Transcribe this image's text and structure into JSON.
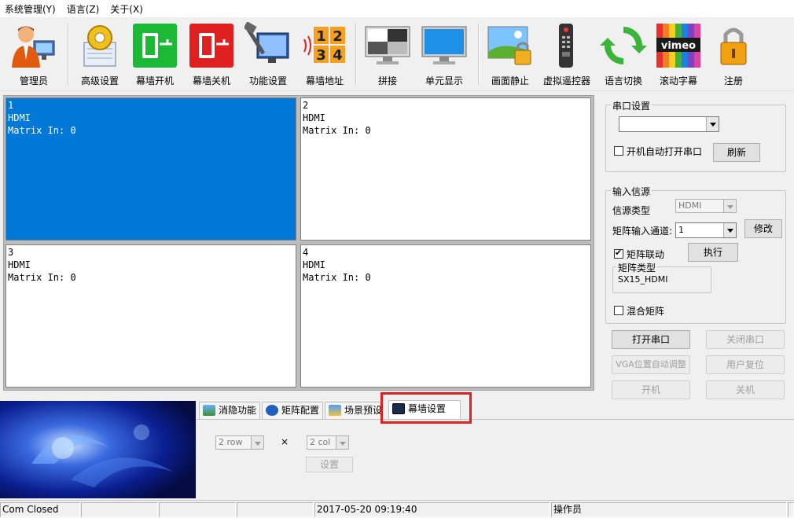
{
  "menu": [
    "系统管理(Y)",
    "语言(Z)",
    "关于(X)"
  ],
  "toolbar": [
    {
      "label": "管理员",
      "icon": "admin-user-icon"
    },
    {
      "label": "高级设置",
      "icon": "advanced-settings-icon"
    },
    {
      "label": "幕墙开机",
      "icon": "wall-power-on-icon"
    },
    {
      "label": "幕墙关机",
      "icon": "wall-power-off-icon"
    },
    {
      "label": "功能设置",
      "icon": "function-settings-icon"
    },
    {
      "label": "幕墙地址",
      "icon": "wall-address-icon"
    },
    {
      "label": "拼接",
      "icon": "splice-monitor-icon"
    },
    {
      "label": "单元显示",
      "icon": "unit-display-monitor-icon"
    },
    {
      "label": "画面静止",
      "icon": "freeze-picture-icon"
    },
    {
      "label": "虚拟遥控器",
      "icon": "remote-control-icon"
    },
    {
      "label": "语言切换",
      "icon": "language-switch-icon"
    },
    {
      "label": "滚动字幕",
      "icon": "scrolling-subtitle-icon"
    },
    {
      "label": "注册",
      "icon": "register-lock-icon"
    }
  ],
  "toolbar_icon_texts": {
    "address_digits": [
      "1",
      "2",
      "3",
      "4"
    ],
    "vimeo_text": "vimeo"
  },
  "screens": [
    {
      "number": "1",
      "source": "HDMI",
      "matrix": "Matrix In: 0",
      "selected": true
    },
    {
      "number": "2",
      "source": "HDMI",
      "matrix": "Matrix In: 0",
      "selected": false
    },
    {
      "number": "3",
      "source": "HDMI",
      "matrix": "Matrix In: 0",
      "selected": false
    },
    {
      "number": "4",
      "source": "HDMI",
      "matrix": "Matrix In: 0",
      "selected": false
    }
  ],
  "serial": {
    "title": "串口设置",
    "port_value": "",
    "auto_open_label": "开机自动打开串口",
    "auto_open_checked": false,
    "refresh_label": "刷新"
  },
  "input": {
    "title": "输入信源",
    "source_type_label": "信源类型",
    "source_type_value": "HDMI",
    "matrix_channel_label": "矩阵输入通道:",
    "matrix_channel_value": "1",
    "modify_label": "修改",
    "matrix_link_label": "矩阵联动",
    "matrix_link_checked": true,
    "execute_label": "执行",
    "matrix_type_title": "矩阵类型",
    "matrix_type_value": "SX15_HDMI",
    "mixed_matrix_label": "混合矩阵",
    "mixed_matrix_checked": false
  },
  "buttons": {
    "open_serial": "打开串口",
    "close_serial": "关闭串口",
    "vga_auto": "VGA位置自动调整",
    "user_reset": "用户复位",
    "power_on": "开机",
    "power_off": "关机"
  },
  "tabs": [
    {
      "label": "消隐功能",
      "icon": "blanking-icon"
    },
    {
      "label": "矩阵配置",
      "icon": "matrix-config-icon"
    },
    {
      "label": "场景预设",
      "icon": "scene-preset-icon"
    },
    {
      "label": "幕墙设置",
      "icon": "wall-settings-icon",
      "active": true
    }
  ],
  "wall_settings": {
    "rows_value": "2 row",
    "times_symbol": "×",
    "cols_value": "2 col",
    "set_label": "设置"
  },
  "status": [
    "Com Closed",
    "",
    "",
    "",
    "2017-05-20 09:19:40",
    "操作员",
    ""
  ],
  "colors": {
    "selected_screen": "#0078d7",
    "highlight_box": "#e02020"
  }
}
